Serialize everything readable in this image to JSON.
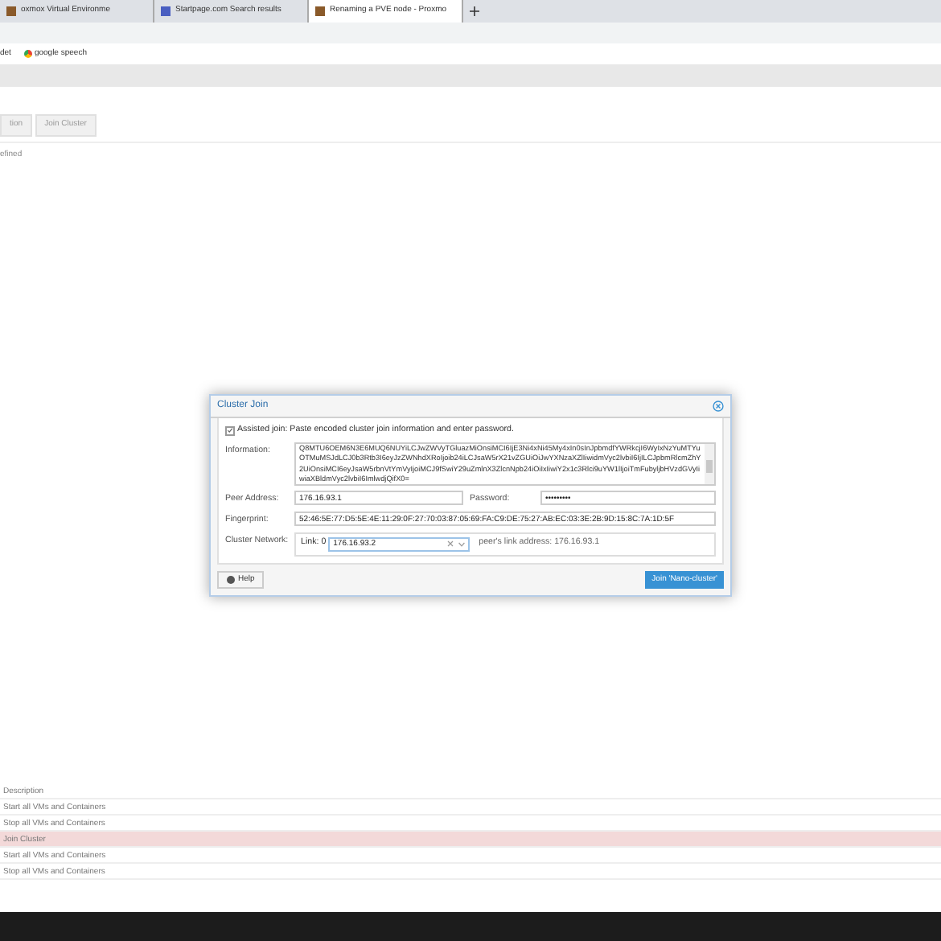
{
  "browser": {
    "tabs": [
      {
        "title": "oxmox Virtual Environme",
        "selected": false
      },
      {
        "title": "Startpage.com Search results",
        "selected": false
      },
      {
        "title": "Renaming a PVE node - Proxmo",
        "selected": true
      }
    ],
    "bookmarks": [
      "det",
      "google speech"
    ]
  },
  "background_page": {
    "toolbar_buttons": [
      "tion",
      "Join Cluster"
    ],
    "info_text": "efined",
    "table": {
      "column": "Description",
      "rows": [
        {
          "text": "Start all VMs and Containers",
          "selected": false
        },
        {
          "text": "Stop all VMs and Containers",
          "selected": false
        },
        {
          "text": "Join Cluster",
          "selected": true
        },
        {
          "text": "Start all VMs and Containers",
          "selected": false
        },
        {
          "text": "Stop all VMs and Containers",
          "selected": false
        }
      ]
    }
  },
  "dialog": {
    "title": "Cluster Join",
    "assisted": {
      "label": "Assisted join: Paste encoded cluster join information and enter password.",
      "checked": true
    },
    "information": {
      "label": "Information:",
      "value": "Q8MTU6OEM6N3E6MUQ6NUYiLCJwZWVyTGluazMiOnsiMCI6IjE3Ni4xNi45My4xIn0sInJpbmdfYWRkcjI6WyIxNzYuMTYuOTMuMSJdLCJ0b3Rtb3I6eyJzZWNhdXRoIjoib24iLCJsaW5rX21vZGUiOiJwYXNzaXZlIiwidmVyc2lvbiI6IjILCJpbmRlcmZhY2UiOnsiMCI6eyJsaW5rbnVtYmVyIjoiMCJ9fSwiY29uZmlnX3ZlcnNpb24iOiIxIiwiY2x1c3Rlci9uYW1lIjoiTmFubyljbHVzdGVyIiwiaXBldmVyc2lvbiI6ImlwdjQifX0="
    },
    "peer_address": {
      "label": "Peer Address:",
      "value": "176.16.93.1"
    },
    "password": {
      "label": "Password:",
      "value": "•••••••••"
    },
    "fingerprint": {
      "label": "Fingerprint:",
      "value": "52:46:5E:77:D5:5E:4E:11:29:0F:27:70:03:87:05:69:FA:C9:DE:75:27:AB:EC:03:3E:2B:9D:15:8C:7A:1D:5F"
    },
    "cluster_network": {
      "label": "Cluster Network:",
      "link_label": "Link:",
      "link_number": "0",
      "value": "176.16.93.2",
      "peer_link": "peer's link address: 176.16.93.1"
    },
    "help_button": "Help",
    "join_button": "Join 'Nano-cluster'"
  }
}
